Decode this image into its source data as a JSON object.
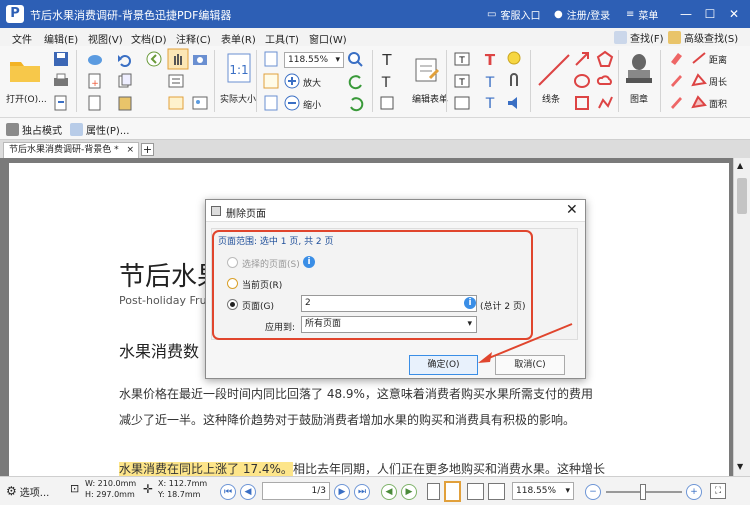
{
  "window": {
    "title": "节后水果消费调研-背景色迅捷PDF编辑器",
    "logo": "P",
    "customer_service": "客服入口",
    "register_login": "注册/登录",
    "menu": "菜单"
  },
  "menubar": {
    "items": [
      "文件",
      "编辑(E)",
      "视图(V)",
      "文档(D)",
      "注释(C)",
      "表单(R)",
      "工具(T)",
      "窗口(W)"
    ],
    "find": "查找(F)",
    "advanced_find": "高级查找(S)"
  },
  "ribbon": {
    "open": "打开(O)...",
    "zoom_value": "118.55%",
    "actual_size": "实际大小",
    "zoom_in": "放大",
    "zoom_out": "缩小",
    "edit_form": "编辑表单",
    "line": "线条",
    "stamp": "图章",
    "distance": "距离",
    "perimeter": "周长",
    "area": "面积",
    "exclusive_mode": "独占模式",
    "properties": "属性(P)..."
  },
  "tab": {
    "label": "节后水果消费调研-背景色 *",
    "close": "×",
    "add": "+"
  },
  "document": {
    "title": "节后水果",
    "subtitle": "Post-holiday Fru",
    "heading": "水果消费数",
    "para1_line1": "水果价格在最近一段时间内同比回落了  48.9%，这意味着消费者购买水果所需支付的费用",
    "para1_line2": "减少了近一半。这种降价趋势对于鼓励消费者增加水果的购买和消费具有积极的影响。",
    "para2_highlight": "水果消费在同比上涨了 17.4%。",
    "para2_rest": "相比去年同期，人们正在更多地购买和消费水果。这种增长"
  },
  "dialog": {
    "title": "删除页面",
    "close": "✕",
    "range_label": "页面范围: 选中 1 页, 共 2 页",
    "opt_selected": "选择的页面(S)",
    "opt_current": "当前页(R)",
    "opt_pages": "页面(G)",
    "pages_value": "2",
    "total_pages": "(总计 2 页)",
    "apply_to_label": "应用到:",
    "apply_to_value": "所有页面",
    "ok": "确定(O)",
    "cancel": "取消(C)",
    "info": "i"
  },
  "status": {
    "options": "选项...",
    "width": "W: 210.0mm",
    "height": "H: 297.0mm",
    "x": "X: 112.7mm",
    "y": "Y: 18.7mm",
    "page": "1",
    "page_total": "/3",
    "zoom": "118.55%"
  },
  "colors": {
    "title_bar": "#2d5fb5",
    "highlight": "#fde58a",
    "annotation_red": "#e0452d",
    "accent_blue": "#3a8ee6"
  }
}
